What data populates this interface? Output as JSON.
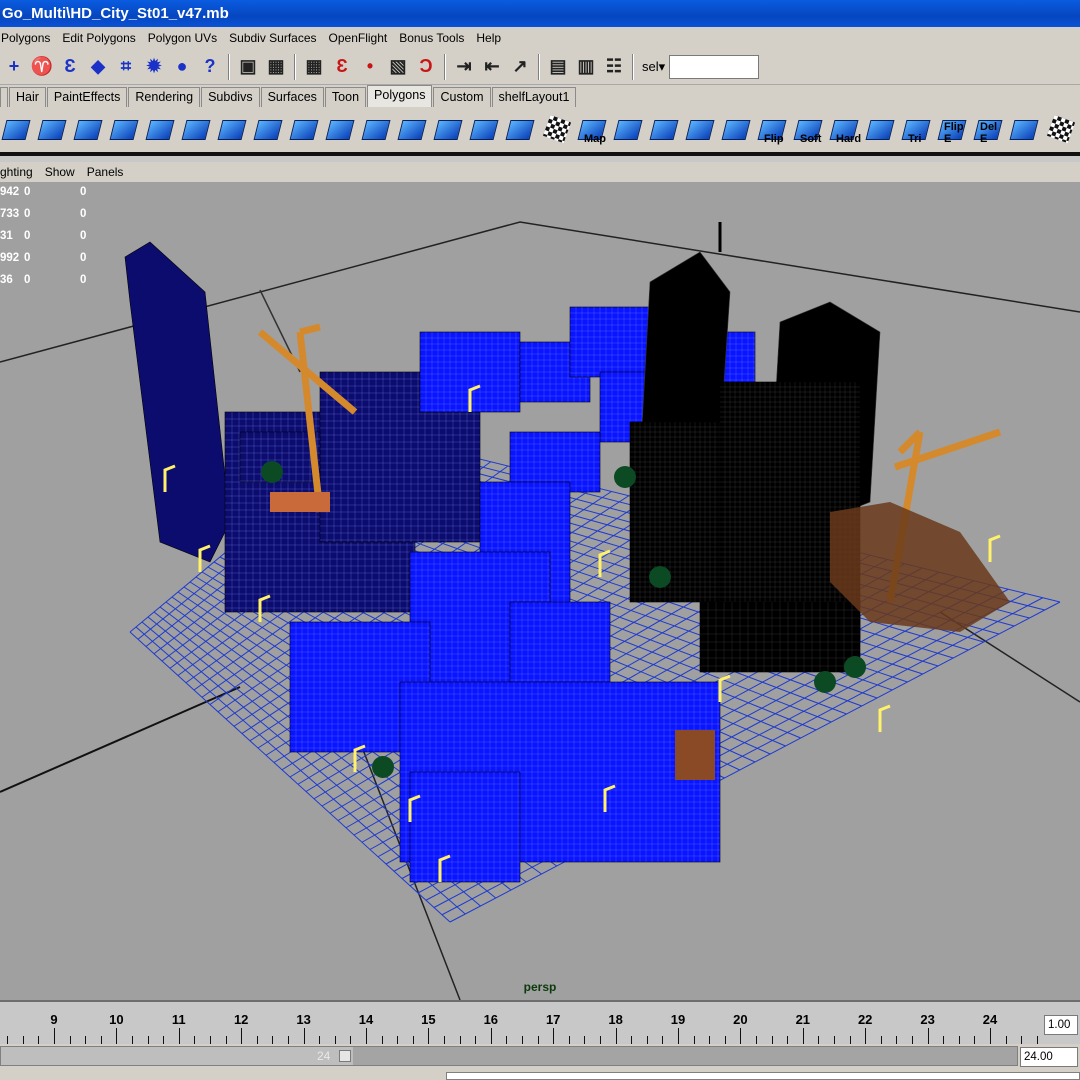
{
  "window": {
    "title": "Go_Multi\\HD_City_St01_v47.mb"
  },
  "menubar": {
    "items": [
      "Polygons",
      "Edit Polygons",
      "Polygon UVs",
      "Subdiv Surfaces",
      "OpenFlight",
      "Bonus Tools",
      "Help"
    ]
  },
  "statusline": {
    "icons": [
      "plus-icon",
      "lasso-icon",
      "curve-icon",
      "cube-icon",
      "frame-icon",
      "sparkle-icon",
      "sphere-icon",
      "help-icon",
      "lock-icon",
      "select-mask-icon",
      "grid-snap-icon",
      "curve-snap-icon",
      "point-snap-icon",
      "plane-snap-icon",
      "magnet-icon",
      "input-icon",
      "output-icon",
      "history-icon",
      "render-icon",
      "ipr-icon",
      "render-settings-icon"
    ],
    "sel_label": "sel",
    "sel_value": ""
  },
  "shelf": {
    "tabs": [
      "Hair",
      "PaintEffects",
      "Rendering",
      "Subdivs",
      "Surfaces",
      "Toon",
      "Polygons",
      "Custom",
      "shelfLayout1"
    ],
    "active_tab": "Polygons",
    "tools": [
      {
        "icon": "poly-icon"
      },
      {
        "icon": "poly-split-icon"
      },
      {
        "icon": "poly-extrude-icon"
      },
      {
        "icon": "poly-face-icon"
      },
      {
        "icon": "poly-bevel-icon"
      },
      {
        "icon": "poly-bridge-icon"
      },
      {
        "icon": "poly-merge-icon"
      },
      {
        "icon": "poly-append-icon"
      },
      {
        "icon": "poly-cut-icon"
      },
      {
        "icon": "poly-wedge-icon"
      },
      {
        "icon": "poly-subdivide-icon"
      },
      {
        "icon": "poly-collapse-icon"
      },
      {
        "icon": "poly-extract-icon"
      },
      {
        "icon": "poly-duplicate-icon"
      },
      {
        "icon": "poly-pivot-icon"
      },
      {
        "icon": "uv-checker-icon"
      },
      {
        "icon": "uv-map-icon",
        "label": "Map"
      },
      {
        "icon": "uv-planar-icon"
      },
      {
        "icon": "uv-cylindrical-icon"
      },
      {
        "icon": "uv-spherical-icon"
      },
      {
        "icon": "uv-layout-icon"
      },
      {
        "icon": "flip-icon",
        "label": "Flip"
      },
      {
        "icon": "soften-icon",
        "label": "Soft"
      },
      {
        "icon": "harden-icon",
        "label": "Hard"
      },
      {
        "icon": "poly-smooth-icon"
      },
      {
        "icon": "triangulate-icon",
        "label": "Tri"
      },
      {
        "icon": "flip-edge-icon",
        "label": "Flip E"
      },
      {
        "icon": "delete-edge-icon",
        "label": "Del E"
      },
      {
        "icon": "poly-cleanup-icon"
      },
      {
        "icon": "uv-checker-2-icon"
      },
      {
        "icon": "uv-checker-3-icon"
      },
      {
        "icon": "poly-more-icon"
      }
    ]
  },
  "panel": {
    "menus": [
      "ghting",
      "Show",
      "Panels"
    ],
    "hud": [
      {
        "a": "942",
        "b": "0",
        "c": "0"
      },
      {
        "a": "733",
        "b": "0",
        "c": "0"
      },
      {
        "a": "31",
        "b": "0",
        "c": "0"
      },
      {
        "a": "992",
        "b": "0",
        "c": "0"
      },
      {
        "a": "36",
        "b": "0",
        "c": "0"
      }
    ],
    "camera": "persp"
  },
  "timeslider": {
    "ticks": [
      "9",
      "10",
      "11",
      "12",
      "13",
      "14",
      "15",
      "16",
      "17",
      "18",
      "19",
      "20",
      "21",
      "22",
      "23",
      "24"
    ],
    "current_frame": "1.00"
  },
  "rangeslider": {
    "range_end_label": "24",
    "end_value": "24.00"
  },
  "colors": {
    "viewport_bg": "#a0a0a0",
    "grid": "#1e3ad0",
    "blue_buildings": "#0a14ff",
    "navy_buildings": "#0c0c6e",
    "black_buildings": "#000000",
    "cranes": "#d48a2c",
    "street_lights": "#fff26a",
    "trees": "#0c4a24",
    "brown_rubble": "#6a3a1a"
  }
}
